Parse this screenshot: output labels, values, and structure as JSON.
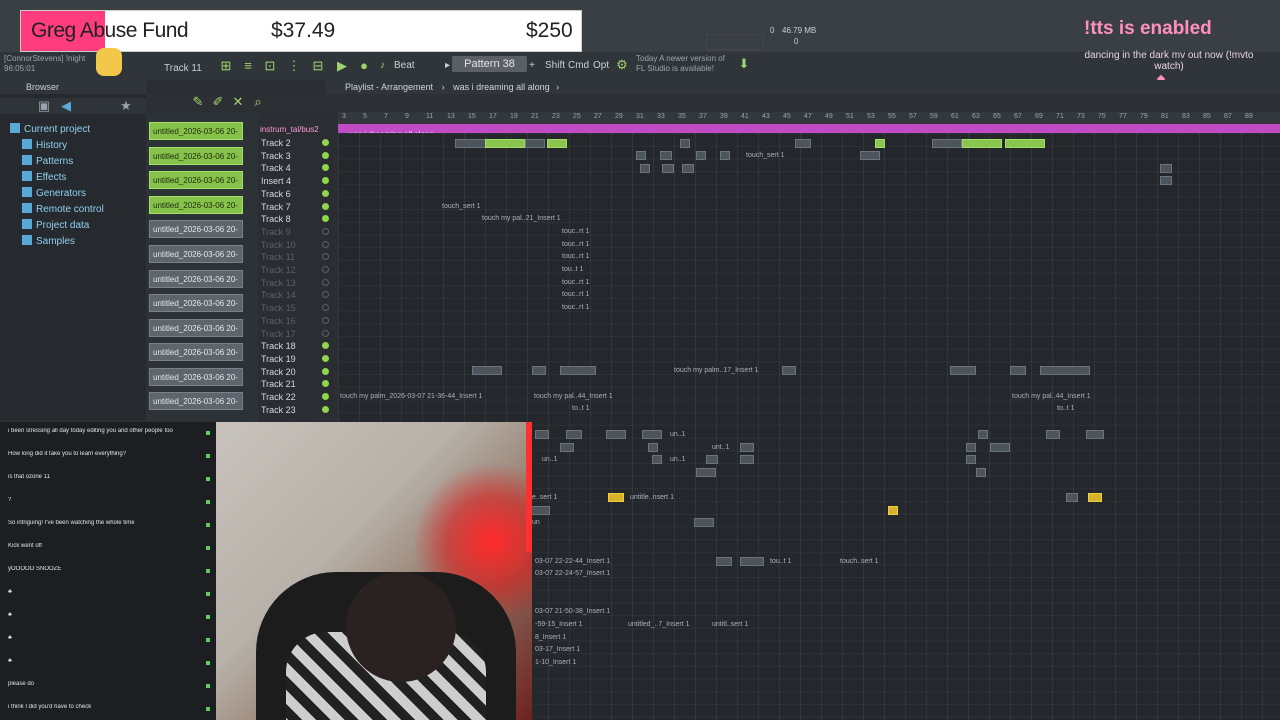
{
  "overlay": {
    "fund_title": "Greg Abuse Fund",
    "fund_current": "$37.49",
    "fund_goal": "$250",
    "enabled_text": "!tts is enabled",
    "dancing_text": "dancing in the dark mv out now (!mvto watch)",
    "user_line1": "[ConnorStevens] !night",
    "user_line2": "96:05:01"
  },
  "toolbar": {
    "track_label": "Track 11",
    "beat_label": "Beat",
    "pattern_label": "Pattern 38",
    "shift_label": "Shift",
    "cmd_label": "Cmd",
    "opt_label": "Opt",
    "notice_prefix": "Today",
    "notice_text": "A newer version of FL Studio is available!",
    "cpu_text": "46.79 MB",
    "zero": "0",
    "zero2": "0"
  },
  "browser": {
    "title": "Browser",
    "items": [
      {
        "label": "Current project"
      },
      {
        "label": "History"
      },
      {
        "label": "Patterns"
      },
      {
        "label": "Effects"
      },
      {
        "label": "Generators"
      },
      {
        "label": "Remote control"
      },
      {
        "label": "Project data"
      },
      {
        "label": "Samples"
      }
    ]
  },
  "clips": [
    "untitled_2026-03-06 20-",
    "untitled_2026-03-06 20-",
    "untitled_2026-03-06 20-",
    "untitled_2026-03-06 20-",
    "untitled_2026-03-06 20-",
    "untitled_2026-03-06 20-",
    "untitled_2026-03-06 20-",
    "untitled_2026-03-06 20-",
    "untitled_2026-03-06 20-",
    "untitled_2026-03-06 20-",
    "untitled_2026-03-06 20-",
    "untitled_2026-03-06 20-"
  ],
  "playlist": {
    "header": "Playlist - Arrangement",
    "song": "was i dreaming all along",
    "lane_label": "was i dreaming all along",
    "instrument_track": "instrum_tal/bus2",
    "tracks": [
      {
        "name": "Track 2",
        "on": true
      },
      {
        "name": "Track 3",
        "on": true
      },
      {
        "name": "Track 4",
        "on": true
      },
      {
        "name": "Insert 4",
        "on": true
      },
      {
        "name": "Track 6",
        "on": true
      },
      {
        "name": "Track 7",
        "on": true
      },
      {
        "name": "Track 8",
        "on": true
      },
      {
        "name": "Track 9",
        "on": false
      },
      {
        "name": "Track 10",
        "on": false
      },
      {
        "name": "Track 11",
        "on": false
      },
      {
        "name": "Track 12",
        "on": false
      },
      {
        "name": "Track 13",
        "on": false
      },
      {
        "name": "Track 14",
        "on": false
      },
      {
        "name": "Track 15",
        "on": false
      },
      {
        "name": "Track 16",
        "on": false
      },
      {
        "name": "Track 17",
        "on": false
      },
      {
        "name": "Track 18",
        "on": true
      },
      {
        "name": "Track 19",
        "on": true
      },
      {
        "name": "Track 20",
        "on": true
      },
      {
        "name": "Track 21",
        "on": true
      },
      {
        "name": "Track 22",
        "on": true
      },
      {
        "name": "Track 23",
        "on": true
      }
    ],
    "ruler": [
      "3",
      "5",
      "7",
      "9",
      "11",
      "13",
      "15",
      "17",
      "19",
      "21",
      "23",
      "25",
      "27",
      "29",
      "31",
      "33",
      "35",
      "37",
      "39",
      "41",
      "43",
      "45",
      "47",
      "49",
      "51",
      "53",
      "55",
      "57",
      "59",
      "61",
      "63",
      "65",
      "67",
      "69",
      "71",
      "73",
      "75",
      "77",
      "79",
      "81",
      "83",
      "85",
      "87",
      "89"
    ],
    "labels": {
      "touch_sert": "touch_sert 1",
      "touch_palm_insert": "touch my pal..21_Insert 1",
      "touch_short": "touc..rt 1",
      "touch_tiny": "tou..t 1",
      "touch_palm17": "touch my palm..17_Insert 1",
      "touch_palm_long": "touch my palm_2026-03-07 21-36-44_Insert 1",
      "touch_palm44": "touch my pal..44_Insert 1",
      "to_t1": "to..t 1",
      "un1": "un..1",
      "unt1": "unt..1",
      "untitle_nsert": "untitle..nsert 1",
      "sert1": "e..sert 1",
      "un": "un",
      "r1": "03-07 22-22-44_Insert 1",
      "r2": "03-07 22-24-57_Insert 1",
      "r3": "03-07 21-50-38_Insert 1",
      "r4": "-59-15_Insert 1",
      "r5": "8_Insert 1",
      "r6": "03-17_Insert 1",
      "r7": "1-10_Insert 1",
      "untitled_insert": "untitled_..7_Insert 1",
      "untitl_sert": "untitl..sert 1",
      "touch_sert2": "touch..sert 1",
      "tou_t1": "tou..t 1"
    }
  },
  "chat": [
    {
      "user": "",
      "text": "i been stressing all day today editing you and other people too"
    },
    {
      "user": "",
      "text": "How long did it take you to learn everything?"
    },
    {
      "user": "",
      "text": "is that ozone 11"
    },
    {
      "user": "",
      "text": "?"
    },
    {
      "user": "",
      "text": "So intriguing! I've been watching the whole time"
    },
    {
      "user": "",
      "text": "Kick went off"
    },
    {
      "user": "",
      "text": "yOOOOO SNOOZE"
    },
    {
      "user": "",
      "text": "♣"
    },
    {
      "user": "",
      "text": "♣"
    },
    {
      "user": "",
      "text": "♣"
    },
    {
      "user": "",
      "text": "♣"
    },
    {
      "user": "",
      "text": "please do"
    },
    {
      "user": "",
      "text": "i think I did you'd have to check"
    }
  ],
  "colors": {
    "accent_green": "#8fd64a",
    "fund_pink": "#ff3c7e",
    "lane_purple": "#c04bc4",
    "text_pink": "#ff8fc0"
  }
}
